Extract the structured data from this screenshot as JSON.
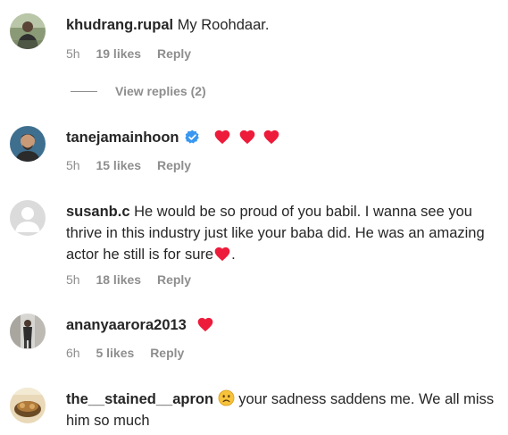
{
  "comments": [
    {
      "username": "khudrang.rupal",
      "text": "My Roohdaar.",
      "time": "5h",
      "likes": "19 likes",
      "reply": "Reply",
      "view_replies": "View replies (2)"
    },
    {
      "username": "tanejamainhoon",
      "verified": true,
      "text": "",
      "hearts": 3,
      "time": "5h",
      "likes": "15 likes",
      "reply": "Reply"
    },
    {
      "username": "susanb.c",
      "text": "He would be so proud of you babil. I wanna see you thrive in this industry just like your baba did. He was an amazing actor he still is for sure",
      "text_tail": ".",
      "time": "5h",
      "likes": "18 likes",
      "reply": "Reply"
    },
    {
      "username": "ananyaarora2013",
      "text": "",
      "hearts": 1,
      "time": "6h",
      "likes": "5 likes",
      "reply": "Reply"
    },
    {
      "username": "the__stained__apron",
      "emoji": "slightly-frowning-face",
      "text": "your sadness saddens me. We all miss him so much"
    }
  ],
  "colors": {
    "text": "#262626",
    "muted": "#8e8e8e",
    "heart": "#ed1c3a",
    "verified": "#3897f0"
  }
}
